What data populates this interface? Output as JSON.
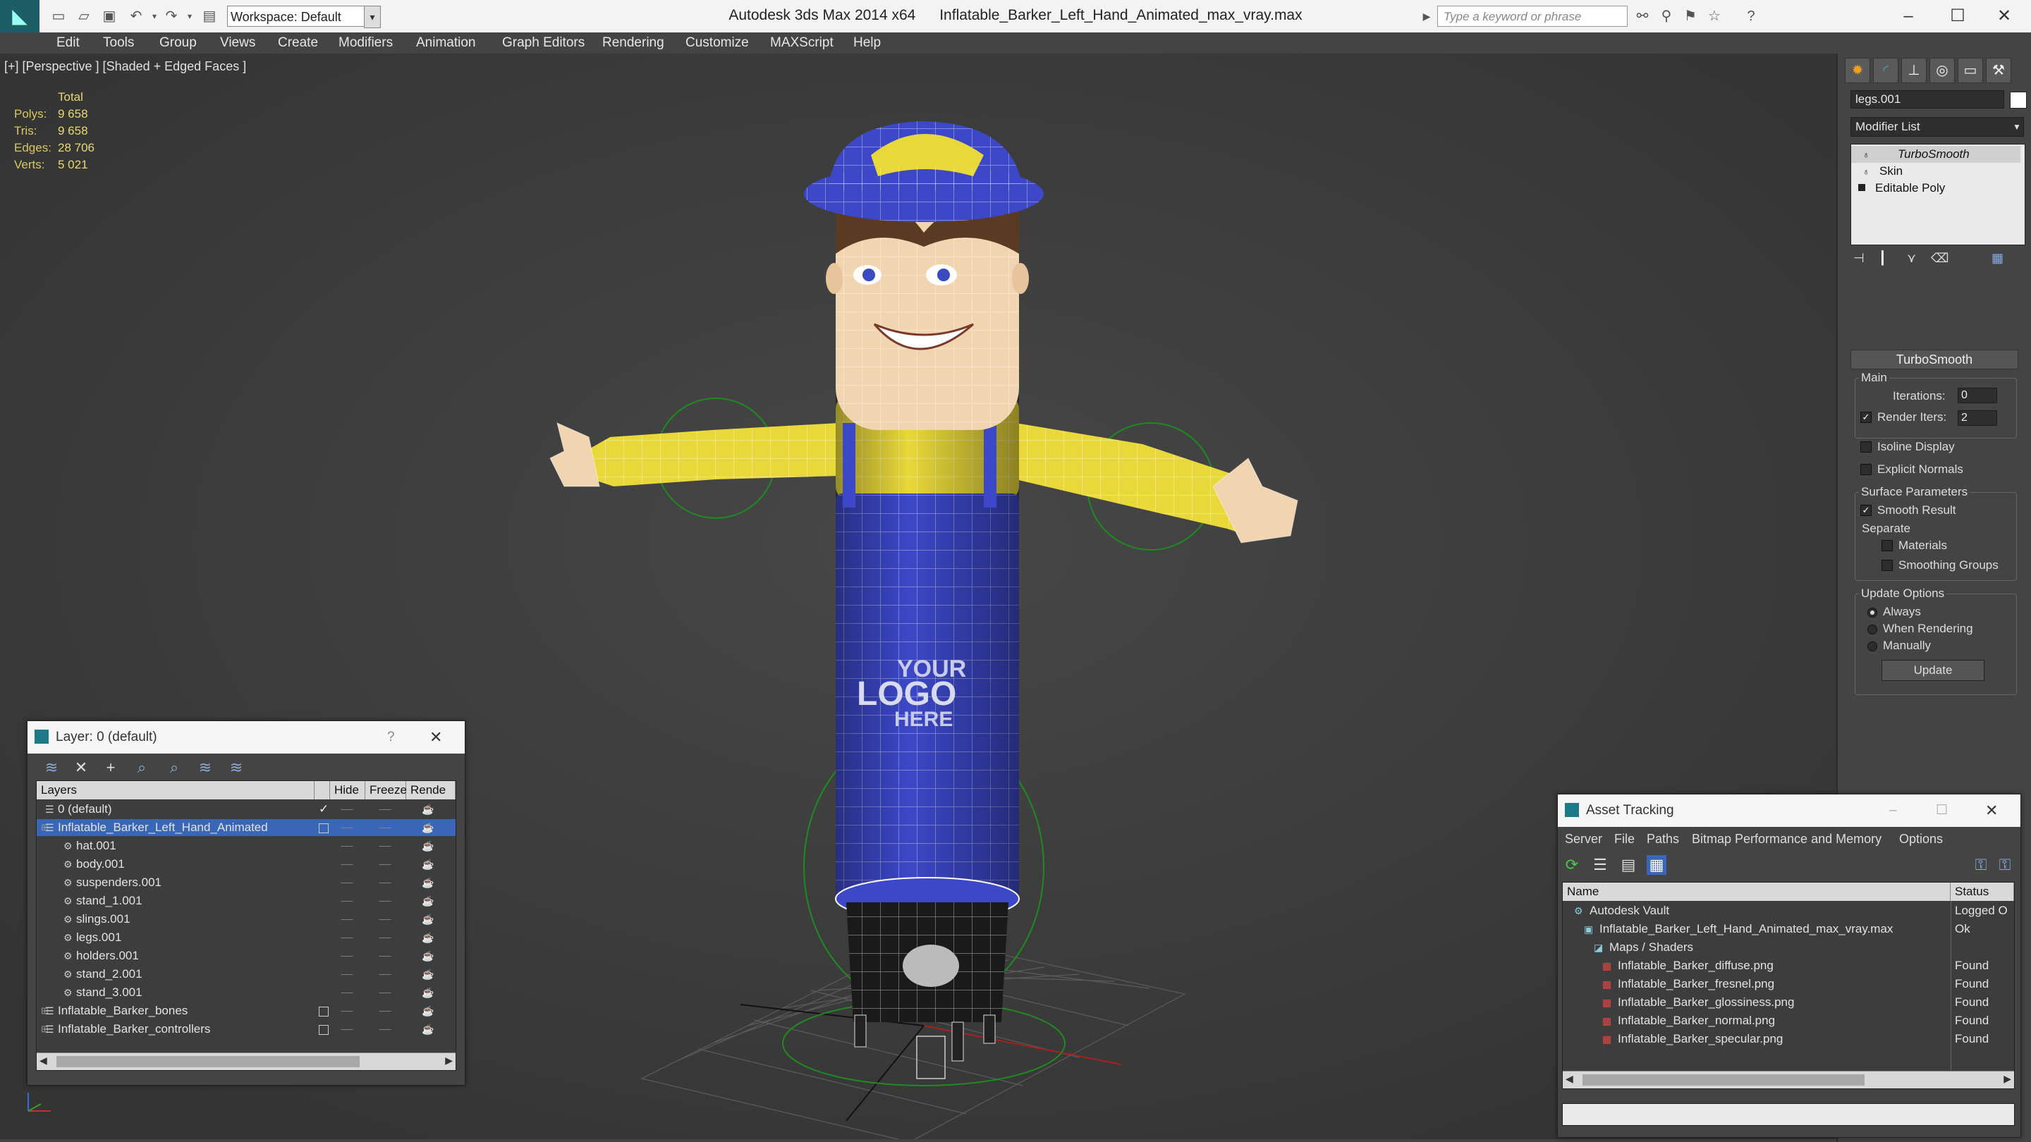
{
  "title_bar": {
    "app_title": "Autodesk 3ds Max  2014 x64",
    "file_name": "Inflatable_Barker_Left_Hand_Animated_max_vray.max",
    "workspace": "Workspace: Default",
    "search_placeholder": "Type a keyword or phrase"
  },
  "menu": [
    "Edit",
    "Tools",
    "Group",
    "Views",
    "Create",
    "Modifiers",
    "Animation",
    "Graph Editors",
    "Rendering",
    "Customize",
    "MAXScript",
    "Help"
  ],
  "viewport": {
    "label": "[+] [Perspective ] [Shaded + Edged Faces ]",
    "stats_header": "Total",
    "stats": [
      {
        "key": "Polys:",
        "value": "9 658"
      },
      {
        "key": "Tris:",
        "value": "9 658"
      },
      {
        "key": "Edges:",
        "value": "28 706"
      },
      {
        "key": "Verts:",
        "value": "5 021"
      }
    ],
    "logo_text": [
      "YOUR",
      "LOGO",
      "HERE"
    ],
    "colors": {
      "shirt": "#e8d83a",
      "overalls": "#3c48c8",
      "skin": "#f1d5b0",
      "background": "#3c3c3c"
    }
  },
  "command_panel": {
    "object_name": "legs.001",
    "modifier_list": "Modifier List",
    "stack": [
      "TurboSmooth",
      "Skin",
      "Editable Poly"
    ],
    "rollout_title": "TurboSmooth",
    "main_group": "Main",
    "iterations_label": "Iterations:",
    "iterations_value": "0",
    "render_iters_label": "Render Iters:",
    "render_iters_value": "2",
    "isoline_label": "Isoline Display",
    "explicit_normals_label": "Explicit Normals",
    "surface_group": "Surface Parameters",
    "smooth_result_label": "Smooth Result",
    "separate_label": "Separate",
    "materials_label": "Materials",
    "smoothing_groups_label": "Smoothing Groups",
    "update_group": "Update Options",
    "update_always": "Always",
    "update_when_rendering": "When Rendering",
    "update_manually": "Manually",
    "update_button": "Update"
  },
  "layer_window": {
    "title": "Layer: 0 (default)",
    "help": "?",
    "columns": [
      "Layers",
      "Hide",
      "Freeze",
      "Rende"
    ],
    "rows": [
      {
        "name": "0 (default)",
        "indent": 0
      },
      {
        "name": "Inflatable_Barker_Left_Hand_Animated",
        "indent": 0
      },
      {
        "name": "hat.001",
        "indent": 1
      },
      {
        "name": "body.001",
        "indent": 1
      },
      {
        "name": "suspenders.001",
        "indent": 1
      },
      {
        "name": "stand_1.001",
        "indent": 1
      },
      {
        "name": "slings.001",
        "indent": 1
      },
      {
        "name": "legs.001",
        "indent": 1
      },
      {
        "name": "holders.001",
        "indent": 1
      },
      {
        "name": "stand_2.001",
        "indent": 1
      },
      {
        "name": "stand_3.001",
        "indent": 1
      },
      {
        "name": "Inflatable_Barker_bones",
        "indent": 0
      },
      {
        "name": "Inflatable_Barker_controllers",
        "indent": 0
      }
    ]
  },
  "asset_window": {
    "title": "Asset Tracking",
    "menu": [
      "Server",
      "File",
      "Paths",
      "Bitmap Performance and Memory",
      "Options"
    ],
    "columns": [
      "Name",
      "Status"
    ],
    "rows": [
      {
        "name": "Autodesk Vault",
        "status": "Logged O"
      },
      {
        "name": "Inflatable_Barker_Left_Hand_Animated_max_vray.max",
        "status": "Ok"
      },
      {
        "name": "Maps / Shaders",
        "status": ""
      },
      {
        "name": "Inflatable_Barker_diffuse.png",
        "status": "Found"
      },
      {
        "name": "Inflatable_Barker_fresnel.png",
        "status": "Found"
      },
      {
        "name": "Inflatable_Barker_glossiness.png",
        "status": "Found"
      },
      {
        "name": "Inflatable_Barker_normal.png",
        "status": "Found"
      },
      {
        "name": "Inflatable_Barker_specular.png",
        "status": "Found"
      }
    ]
  }
}
